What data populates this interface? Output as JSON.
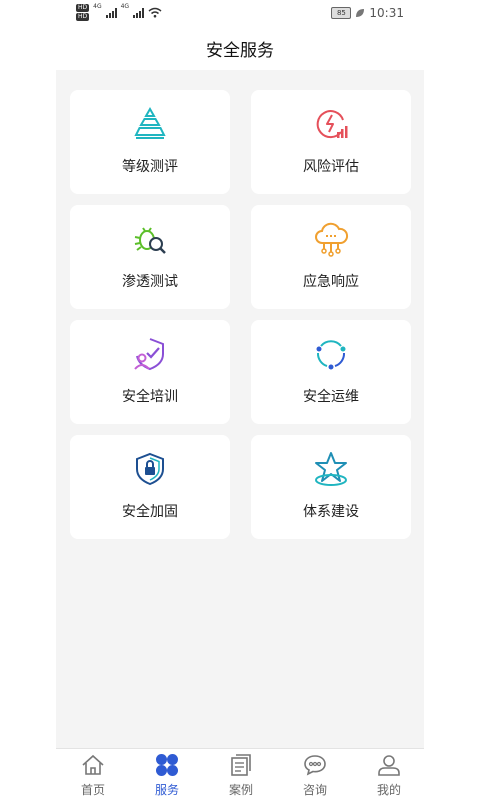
{
  "status_bar": {
    "battery": "85",
    "time": "10:31",
    "network": "4G"
  },
  "header": {
    "title": "安全服务"
  },
  "services": [
    {
      "label": "等级测评",
      "icon": "pyramid-icon"
    },
    {
      "label": "风险评估",
      "icon": "power-chart-icon"
    },
    {
      "label": "渗透测试",
      "icon": "bug-search-icon"
    },
    {
      "label": "应急响应",
      "icon": "cloud-network-icon"
    },
    {
      "label": "安全培训",
      "icon": "shield-user-icon"
    },
    {
      "label": "安全运维",
      "icon": "cycle-icon"
    },
    {
      "label": "安全加固",
      "icon": "shield-lock-icon"
    },
    {
      "label": "体系建设",
      "icon": "star-base-icon"
    }
  ],
  "tabs": [
    {
      "label": "首页",
      "icon": "home-icon"
    },
    {
      "label": "服务",
      "icon": "grid-icon",
      "active": true
    },
    {
      "label": "案例",
      "icon": "cases-icon"
    },
    {
      "label": "咨询",
      "icon": "chat-icon"
    },
    {
      "label": "我的",
      "icon": "user-icon"
    }
  ],
  "colors": {
    "accent": "#2f5bd3",
    "teal": "#1fb5c0",
    "red": "#e5505a",
    "green": "#5cbf2a",
    "orange": "#f0a030",
    "purple": "#8a4fd6",
    "navy": "#1d4f91"
  }
}
